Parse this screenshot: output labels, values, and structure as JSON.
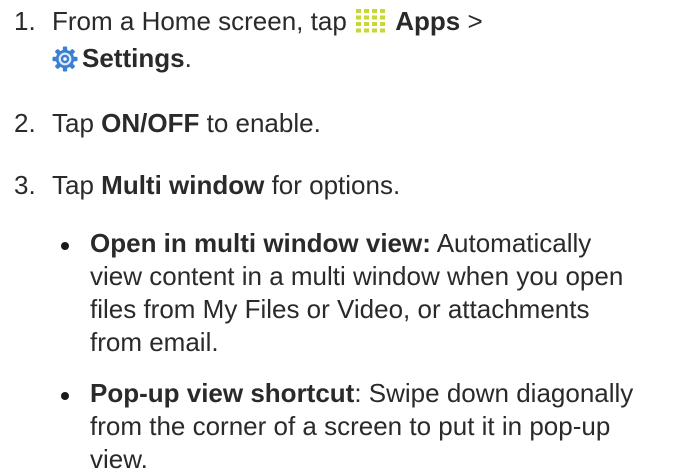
{
  "steps": [
    {
      "number": "1.",
      "text_before": "From a Home screen, tap",
      "apps_label": "Apps",
      "separator": ">",
      "settings_label": "Settings",
      "end": "."
    },
    {
      "number": "2.",
      "prefix": "Tap ",
      "bold": "ON/OFF",
      "suffix": " to enable."
    },
    {
      "number": "3.",
      "prefix": "Tap ",
      "bold": "Multi window",
      "suffix": " for options."
    }
  ],
  "bullets": [
    {
      "term": "Open in multi window view:",
      "lines": [
        " Automatically",
        "view content in a multi window when you open",
        "files from My Files or Video, or attachments",
        "from email."
      ]
    },
    {
      "term": "Pop-up view shortcut",
      "lines": [
        ": Swipe down diagonally",
        "from the corner of a screen to put it in pop-up",
        "view."
      ]
    }
  ],
  "icons": {
    "apps": "apps-grid-icon",
    "settings": "settings-gear-icon"
  },
  "colors": {
    "text": "#2a2a2a",
    "apps_icon": "#c8d63a",
    "settings_icon": "#3a7fd0"
  }
}
